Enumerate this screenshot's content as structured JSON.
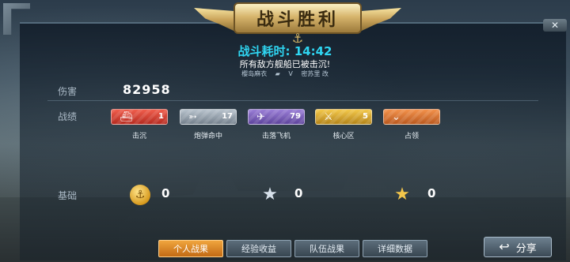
{
  "header": {
    "title": "战斗胜利",
    "time_text": "战斗耗时: 14:42",
    "result_text": "所有敌方舰船已被击沉!",
    "player_name": "樱岛麻衣",
    "vs_text": "V",
    "opponent_name": "密苏里 改",
    "close_icon": "✕"
  },
  "damage": {
    "label": "伤害",
    "value": "82958"
  },
  "achievements": {
    "label": "战绩",
    "items": [
      {
        "icon": "ship-icon",
        "count": "1",
        "label": "击沉",
        "glyph": "⛴"
      },
      {
        "icon": "shell-icon",
        "count": "17",
        "label": "炮弹命中",
        "glyph": "➳"
      },
      {
        "icon": "plane-icon",
        "count": "79",
        "label": "击落飞机",
        "glyph": "✈"
      },
      {
        "icon": "gun-icon",
        "count": "5",
        "label": "核心区",
        "glyph": "⚔"
      },
      {
        "icon": "chevron-icon",
        "count": "",
        "label": "占领",
        "glyph": "⌄"
      }
    ]
  },
  "basic": {
    "label": "基础",
    "coin_value": "0",
    "silver_star_value": "0",
    "gold_star_value": "0",
    "coin_glyph": "⚓",
    "star_glyph": "★"
  },
  "tabs": [
    {
      "label": "个人战果",
      "active": true
    },
    {
      "label": "经验收益",
      "active": false
    },
    {
      "label": "队伍战果",
      "active": false
    },
    {
      "label": "详细数据",
      "active": false
    }
  ],
  "share": {
    "label": "分享",
    "icon": "↩"
  },
  "colors": {
    "time_text": "#2fd6f2",
    "active_tab": "#f0a53e",
    "gold": "#d7b56c"
  }
}
